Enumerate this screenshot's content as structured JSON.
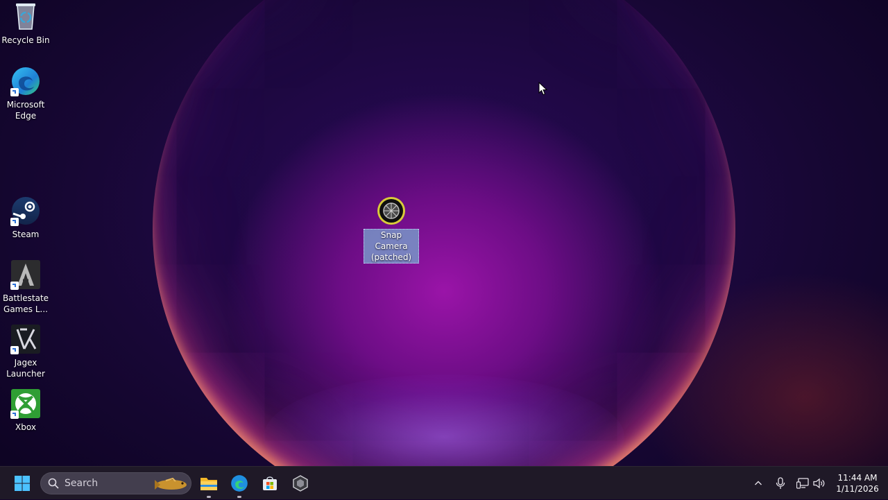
{
  "desktop": {
    "icons": [
      {
        "label": "Recycle Bin",
        "icon": "recycle-bin-icon"
      },
      {
        "label": "Microsoft Edge",
        "icon": "edge-icon"
      },
      {
        "label": "Steam",
        "icon": "steam-icon"
      },
      {
        "label": "Battlestate Games L...",
        "icon": "battlestate-icon"
      },
      {
        "label": "Jagex Launcher",
        "icon": "jagex-icon"
      },
      {
        "label": "Xbox",
        "icon": "xbox-icon"
      }
    ],
    "selected_icon": {
      "label": "Snap Camera (patched)",
      "icon": "snap-camera-icon"
    }
  },
  "taskbar": {
    "search_placeholder": "Search",
    "apps": [
      {
        "icon": "file-explorer-icon",
        "running": true
      },
      {
        "icon": "edge-icon",
        "running": true
      },
      {
        "icon": "microsoft-store-icon",
        "running": false
      },
      {
        "icon": "unity-hub-icon",
        "running": false
      }
    ],
    "tray": {
      "icons": [
        "chevron-up-icon",
        "microphone-icon",
        "network-icon",
        "volume-icon"
      ]
    },
    "clock": {
      "time": "11:44 AM",
      "date": "1/11/2026"
    }
  },
  "colors": {
    "taskbar_bg": "#201a28",
    "accent_blue": "#2b6fd6",
    "selection": "#7896c8"
  }
}
